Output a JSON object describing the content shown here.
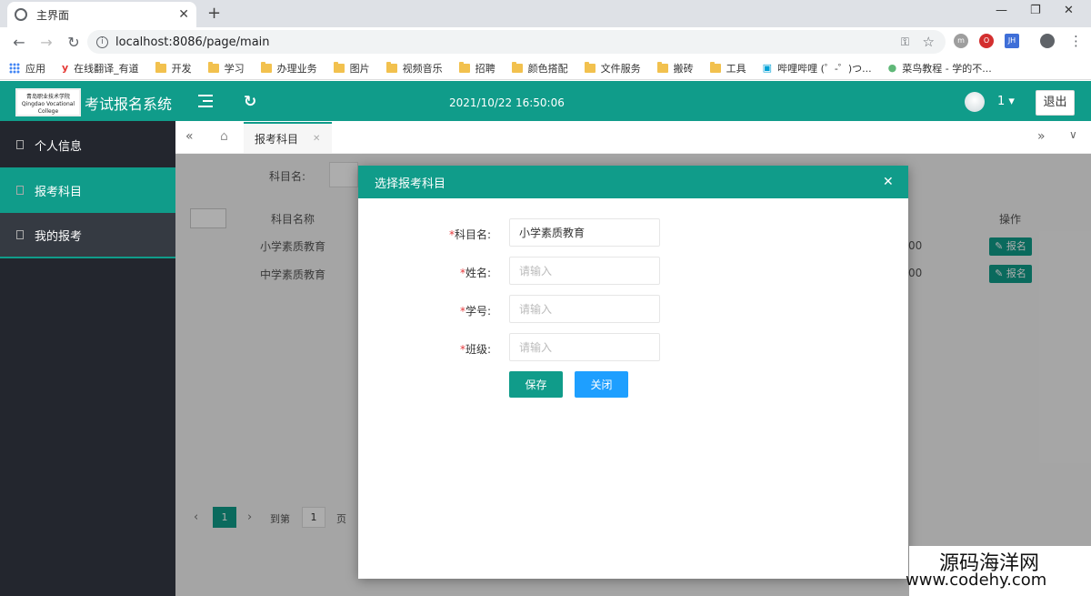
{
  "browser": {
    "tab_title": "主界面",
    "tab_close": "✕",
    "new_tab": "+",
    "url": "localhost:8086/page/main",
    "window_controls": [
      "—",
      "❐",
      "✕"
    ],
    "bookmarks": [
      "应用",
      "在线翻译_有道",
      "开发",
      "学习",
      "办理业务",
      "图片",
      "视频音乐",
      "招聘",
      "颜色搭配",
      "文件服务",
      "搬砖",
      "工具",
      "哔哩哔哩 (゜-゜)つ...",
      "菜鸟教程 - 学的不..."
    ]
  },
  "header": {
    "logo_text": "青岛职业技术学院 Qingdao Vocational College",
    "title": "考试报名系统",
    "datetime": "2021/10/22 16:50:06",
    "username": "1 ▾",
    "logout_label": "退出"
  },
  "sidebar": {
    "items": [
      {
        "label": "个人信息"
      },
      {
        "label": "报考科目"
      },
      {
        "label": "我的报考"
      }
    ]
  },
  "tabbar": {
    "active_tab": "报考科目",
    "left_arrows": "«",
    "right_arrows": "»",
    "down": "∨"
  },
  "background_page": {
    "search_label": "科目名:",
    "col_subject": "科目名称",
    "col_action": "操作",
    "rows": [
      {
        "subject": "小学素质教育",
        "fee": "00",
        "action": "✎ 报名"
      },
      {
        "subject": "中学素质教育",
        "fee": "00",
        "action": "✎ 报名"
      }
    ],
    "pagination": {
      "current": "1",
      "goto_label": "到第",
      "goto_value": "1",
      "page_suffix": "页"
    }
  },
  "modal": {
    "title": "选择报考科目",
    "close": "✕",
    "fields": [
      {
        "label": "科目名:",
        "value": "小学素质教育",
        "placeholder": ""
      },
      {
        "label": "姓名:",
        "value": "",
        "placeholder": "请输入"
      },
      {
        "label": "学号:",
        "value": "",
        "placeholder": "请输入"
      },
      {
        "label": "班级:",
        "value": "",
        "placeholder": "请输入"
      }
    ],
    "required_mark": "*",
    "save_label": "保存",
    "close_label": "关闭"
  },
  "watermark": {
    "line1": "源码海洋网",
    "line2": "www.codehy.com"
  },
  "colors": {
    "primary": "#109c8a",
    "blue": "#1e9fff",
    "sidebar": "#23262e"
  }
}
